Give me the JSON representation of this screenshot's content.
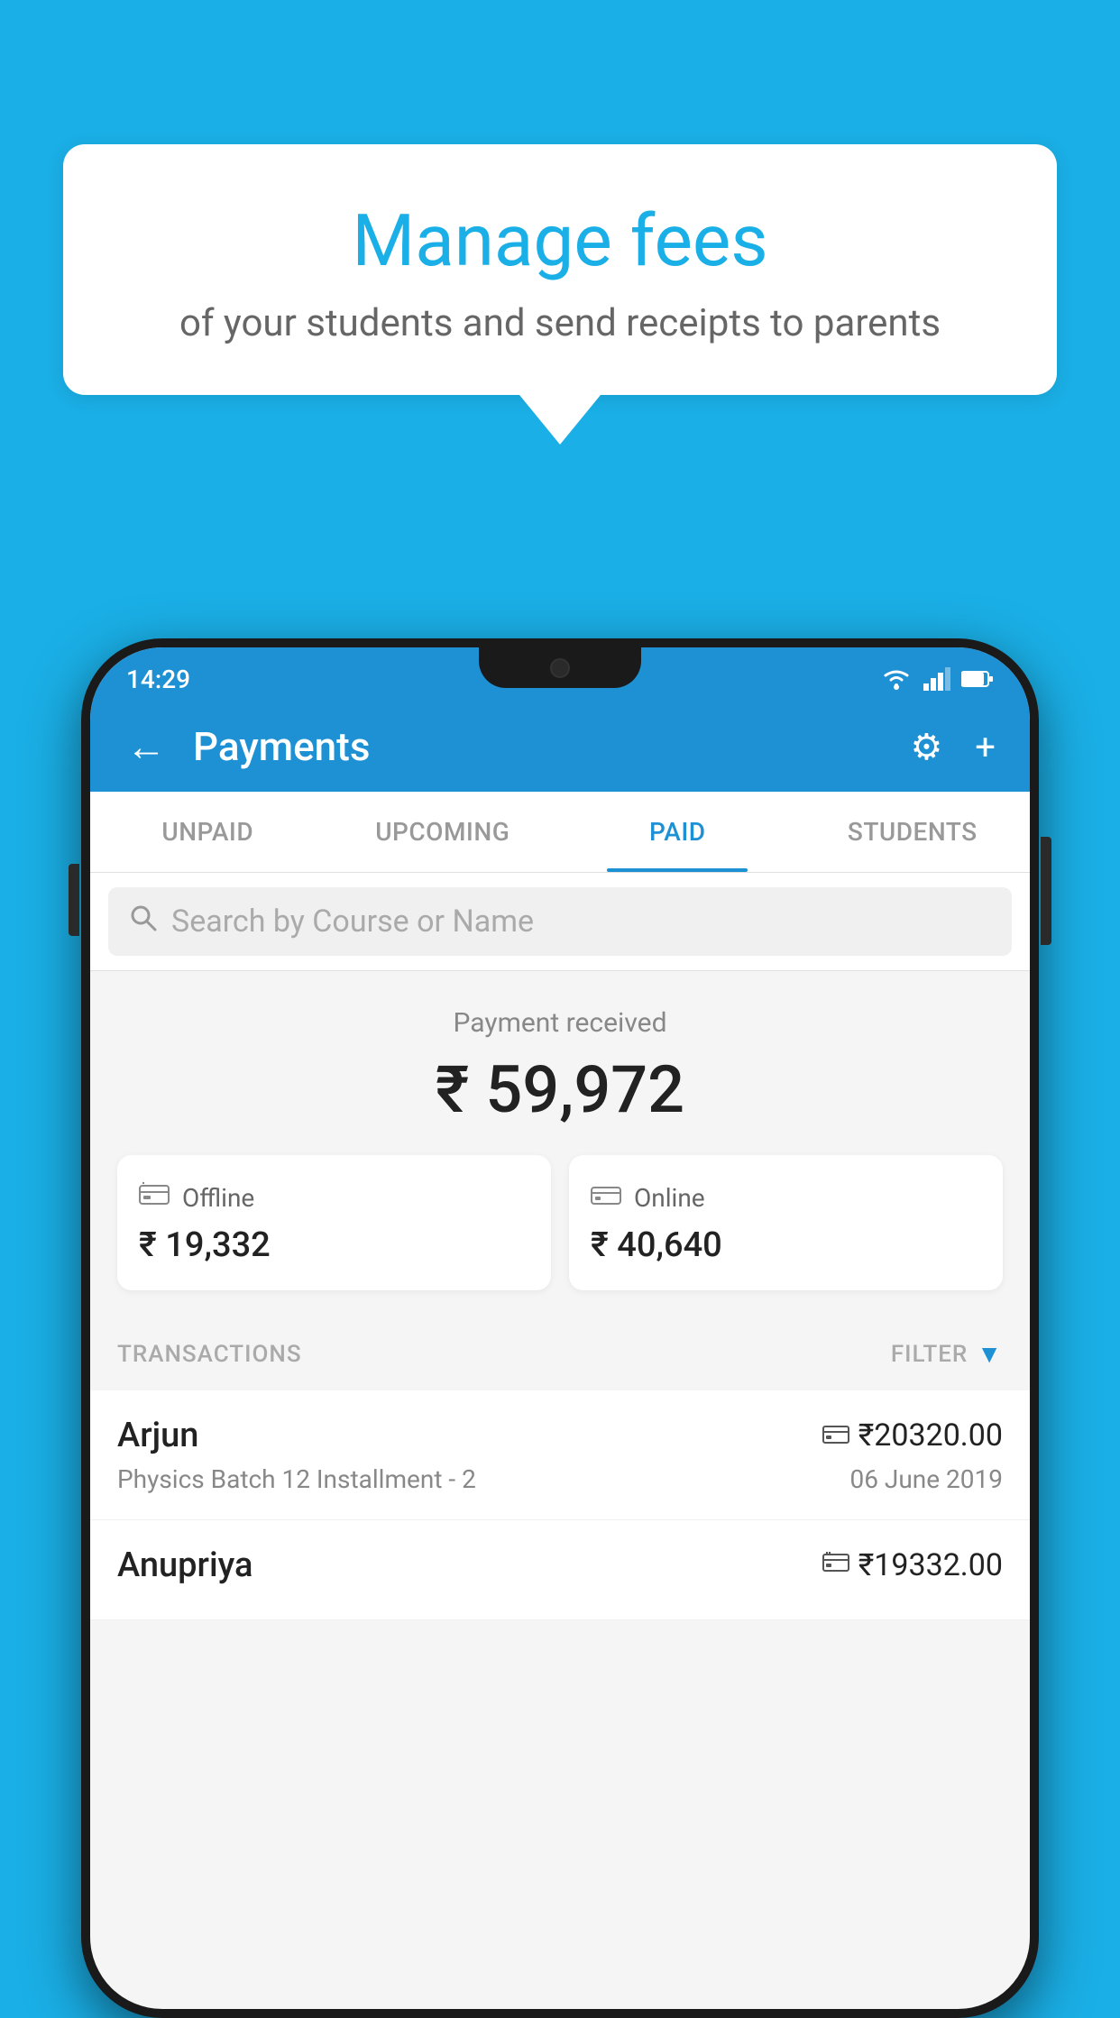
{
  "background": {
    "color": "#1AAFE6"
  },
  "speech_bubble": {
    "title": "Manage fees",
    "subtitle": "of your students and send receipts to parents"
  },
  "status_bar": {
    "time": "14:29"
  },
  "app_bar": {
    "title": "Payments",
    "back_label": "←",
    "settings_label": "⚙",
    "add_label": "+"
  },
  "tabs": [
    {
      "label": "UNPAID",
      "active": false
    },
    {
      "label": "UPCOMING",
      "active": false
    },
    {
      "label": "PAID",
      "active": true
    },
    {
      "label": "STUDENTS",
      "active": false
    }
  ],
  "search": {
    "placeholder": "Search by Course or Name"
  },
  "payment_summary": {
    "label": "Payment received",
    "amount": "₹ 59,972",
    "offline": {
      "type": "Offline",
      "amount": "₹ 19,332"
    },
    "online": {
      "type": "Online",
      "amount": "₹ 40,640"
    }
  },
  "transactions": {
    "header": "TRANSACTIONS",
    "filter_label": "FILTER",
    "items": [
      {
        "name": "Arjun",
        "amount": "₹20320.00",
        "payment_type": "online",
        "course": "Physics Batch 12 Installment - 2",
        "date": "06 June 2019"
      },
      {
        "name": "Anupriya",
        "amount": "₹19332.00",
        "payment_type": "offline",
        "course": "",
        "date": ""
      }
    ]
  }
}
